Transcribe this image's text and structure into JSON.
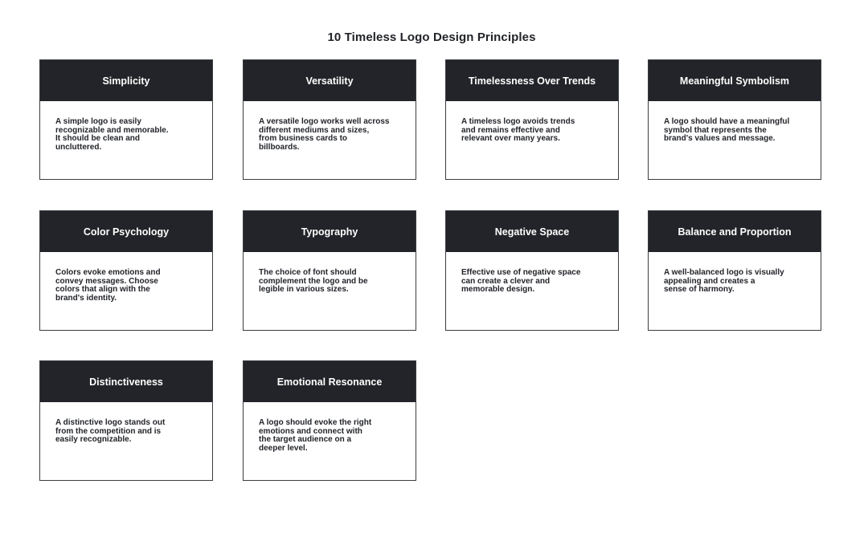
{
  "title": "10 Timeless Logo Design Principles",
  "colors": {
    "header_bg": "#222429",
    "header_text": "#ffffff",
    "body_bg": "#ffffff",
    "border": "#3a3d42"
  },
  "cards": [
    {
      "title": "Simplicity",
      "text": "A simple logo is easily\nrecognizable and memorable.\nIt should be clean and\nuncluttered."
    },
    {
      "title": "Versatility",
      "text": "A versatile logo works well across\ndifferent mediums and sizes,\nfrom business cards to\nbillboards."
    },
    {
      "title": "Timelessness Over Trends",
      "text": "A timeless logo avoids trends\nand remains effective and\nrelevant over many years."
    },
    {
      "title": "Meaningful Symbolism",
      "text": "A logo should have a meaningful\nsymbol that represents the\nbrand's values and message."
    },
    {
      "title": "Color Psychology",
      "text": "Colors evoke emotions and\nconvey messages. Choose\ncolors that align with the\nbrand's identity."
    },
    {
      "title": "Typography",
      "text": "The choice of font should\ncomplement the logo and be\nlegible in various sizes."
    },
    {
      "title": "Negative Space",
      "text": "Effective use of negative space\ncan create a clever and\nmemorable design."
    },
    {
      "title": "Balance and Proportion",
      "text": "A well-balanced logo is visually\nappealing and creates a\nsense of harmony."
    },
    {
      "title": "Distinctiveness",
      "text": "A distinctive logo stands out\nfrom the competition and is\neasily recognizable."
    },
    {
      "title": "Emotional Resonance",
      "text": "A logo should evoke the right\nemotions and connect with\nthe target audience on a\ndeeper level."
    }
  ]
}
